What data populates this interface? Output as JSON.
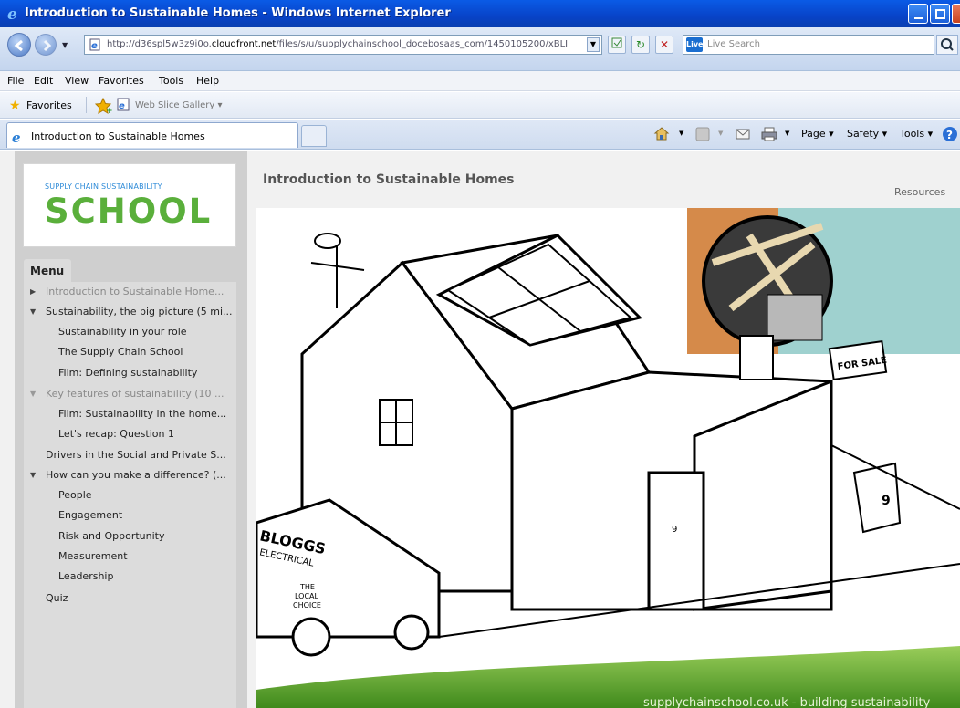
{
  "window": {
    "title": "Introduction to Sustainable Homes - Windows Internet Explorer"
  },
  "address_bar": {
    "url_prefix": "http://d36spl5w3z9i0o.",
    "url_domain": "cloudfront.net",
    "url_suffix": "/files/s/u/supplychainschool_docebosaas_com/1450105200/xBLI"
  },
  "search": {
    "placeholder": "Live Search",
    "logo": "Live"
  },
  "menubar": {
    "items": [
      "File",
      "Edit",
      "View",
      "Favorites",
      "Tools",
      "Help"
    ]
  },
  "favorites_bar": {
    "favorites_label": "Favorites",
    "web_slice_label": "Web Slice Gallery ▾"
  },
  "tab": {
    "label": "Introduction to Sustainable Homes"
  },
  "command_bar": {
    "page": "Page ▾",
    "safety": "Safety ▾",
    "tools": "Tools ▾"
  },
  "logo": {
    "tagline": "SUPPLY CHAIN SUSTAINABILITY",
    "name": "SCHOOL"
  },
  "menu": {
    "heading": "Menu",
    "items": [
      {
        "label": "Introduction to Sustainable Home...",
        "level": 0,
        "marker": "collapsed",
        "state": "visited"
      },
      {
        "label": "Sustainability, the big picture (5 mi...",
        "level": 0,
        "marker": "expanded",
        "state": "normal"
      },
      {
        "label": "Sustainability in your role",
        "level": 1,
        "state": "normal"
      },
      {
        "label": "The Supply Chain School",
        "level": 1,
        "state": "normal"
      },
      {
        "label": "Film: Defining sustainability",
        "level": 1,
        "state": "normal"
      },
      {
        "label": "Key features of sustainability (10 ...",
        "level": 0,
        "marker": "expanded",
        "state": "visited"
      },
      {
        "label": "Film: Sustainability in the home...",
        "level": 1,
        "state": "normal"
      },
      {
        "label": "Let's recap: Question 1",
        "level": 1,
        "state": "normal"
      },
      {
        "label": "Drivers in the Social and Private S...",
        "level": 0,
        "state": "normal"
      },
      {
        "label": "How can you make a difference? (...",
        "level": 0,
        "marker": "expanded",
        "state": "normal"
      },
      {
        "label": "People",
        "level": 1,
        "state": "normal"
      },
      {
        "label": "Engagement",
        "level": 1,
        "state": "normal"
      },
      {
        "label": "Risk and Opportunity",
        "level": 1,
        "state": "normal"
      },
      {
        "label": "Measurement",
        "level": 1,
        "state": "normal"
      },
      {
        "label": "Leadership",
        "level": 1,
        "state": "normal"
      },
      {
        "label": "Quiz",
        "level": 0,
        "state": "normal"
      }
    ]
  },
  "content": {
    "title": "Introduction to Sustainable Homes",
    "resources_link": "Resources",
    "illustration_texts": {
      "van_brand": "BLOGGS",
      "van_sub": "ELECTRICAL",
      "van_slogan_1": "THE",
      "van_slogan_2": "LOCAL",
      "van_slogan_3": "CHOICE",
      "sign": "FOR SALE",
      "bin_number": "9",
      "door_number": "9",
      "footer_url": "supplychainschool.co.uk - building sustainability"
    }
  },
  "colors": {
    "titlebar": "#0a5be6",
    "logo_green": "#5aaf3b",
    "logo_blue": "#2e8bd8",
    "sidebar_bg": "#cfcfcf",
    "menu_bg": "#dcdcdc",
    "grass": "#6bb22e"
  }
}
